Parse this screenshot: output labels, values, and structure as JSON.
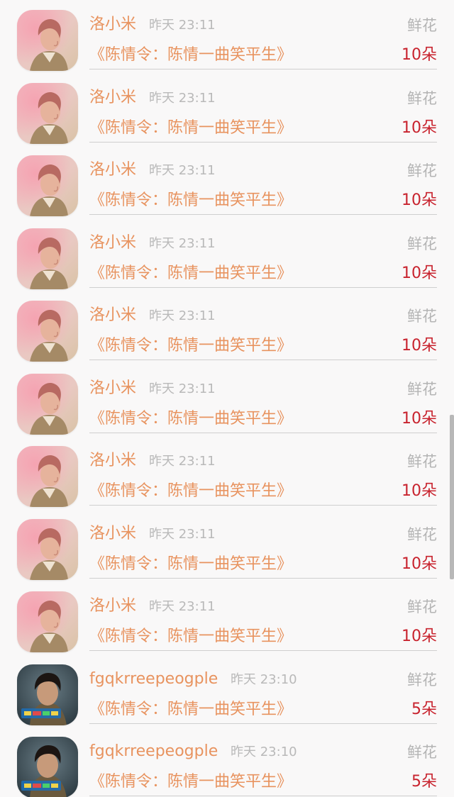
{
  "items": [
    {
      "avatar": "pink-portrait",
      "name": "洛小米",
      "time": "昨天 23:11",
      "gift": "鲜花",
      "title": "《陈情令：陈情一曲笑平生》",
      "count": "10朵"
    },
    {
      "avatar": "pink-portrait",
      "name": "洛小米",
      "time": "昨天 23:11",
      "gift": "鲜花",
      "title": "《陈情令：陈情一曲笑平生》",
      "count": "10朵"
    },
    {
      "avatar": "pink-portrait",
      "name": "洛小米",
      "time": "昨天 23:11",
      "gift": "鲜花",
      "title": "《陈情令：陈情一曲笑平生》",
      "count": "10朵"
    },
    {
      "avatar": "pink-portrait",
      "name": "洛小米",
      "time": "昨天 23:11",
      "gift": "鲜花",
      "title": "《陈情令：陈情一曲笑平生》",
      "count": "10朵"
    },
    {
      "avatar": "pink-portrait",
      "name": "洛小米",
      "time": "昨天 23:11",
      "gift": "鲜花",
      "title": "《陈情令：陈情一曲笑平生》",
      "count": "10朵"
    },
    {
      "avatar": "pink-portrait",
      "name": "洛小米",
      "time": "昨天 23:11",
      "gift": "鲜花",
      "title": "《陈情令：陈情一曲笑平生》",
      "count": "10朵"
    },
    {
      "avatar": "pink-portrait",
      "name": "洛小米",
      "time": "昨天 23:11",
      "gift": "鲜花",
      "title": "《陈情令：陈情一曲笑平生》",
      "count": "10朵"
    },
    {
      "avatar": "pink-portrait",
      "name": "洛小米",
      "time": "昨天 23:11",
      "gift": "鲜花",
      "title": "《陈情令：陈情一曲笑平生》",
      "count": "10朵"
    },
    {
      "avatar": "pink-portrait",
      "name": "洛小米",
      "time": "昨天 23:11",
      "gift": "鲜花",
      "title": "《陈情令：陈情一曲笑平生》",
      "count": "10朵"
    },
    {
      "avatar": "dark-portrait",
      "name": "fgqkrreepeogple",
      "time": "昨天 23:10",
      "gift": "鲜花",
      "title": "《陈情令：陈情一曲笑平生》",
      "count": "5朵"
    },
    {
      "avatar": "dark-portrait",
      "name": "fgqkrreepeogple",
      "time": "昨天 23:10",
      "gift": "鲜花",
      "title": "《陈情令：陈情一曲笑平生》",
      "count": "5朵"
    }
  ],
  "colors": {
    "background": "#f9f8f8",
    "name": "#e8935f",
    "time": "#b9b9b9",
    "gift": "#b4b4b4",
    "count": "#c8232e",
    "divider": "#cfcfcf"
  }
}
